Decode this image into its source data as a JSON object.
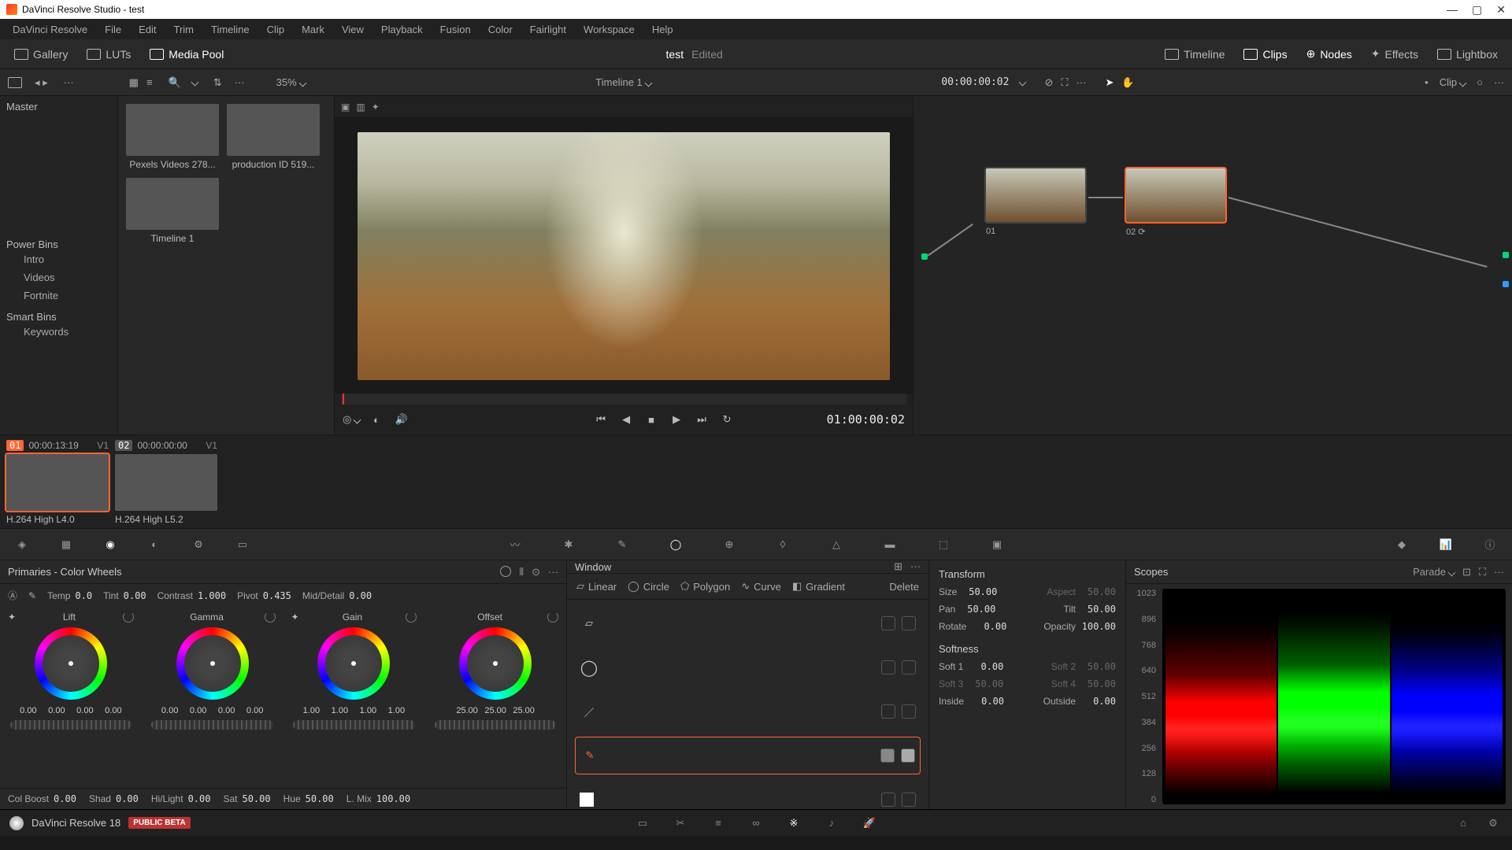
{
  "titlebar": {
    "text": "DaVinci Resolve Studio - test"
  },
  "menu": [
    "DaVinci Resolve",
    "File",
    "Edit",
    "Trim",
    "Timeline",
    "Clip",
    "Mark",
    "View",
    "Playback",
    "Fusion",
    "Color",
    "Fairlight",
    "Workspace",
    "Help"
  ],
  "toptool": {
    "gallery": "Gallery",
    "luts": "LUTs",
    "mediapool": "Media Pool",
    "project_title": "test",
    "project_state": "Edited",
    "timeline": "Timeline",
    "clips": "Clips",
    "nodes": "Nodes",
    "effects": "Effects",
    "lightbox": "Lightbox"
  },
  "subtool": {
    "zoom": "35%",
    "timeline_name": "Timeline 1",
    "timecode": "00:00:00:02",
    "clip_label": "Clip"
  },
  "leftpane": {
    "master": "Master",
    "powerbins_title": "Power Bins",
    "powerbins": [
      "Intro",
      "Videos",
      "Fortnite"
    ],
    "smartbins_title": "Smart Bins",
    "smartbins": [
      "Keywords"
    ]
  },
  "media": {
    "items": [
      {
        "name": "Pexels Videos 278..."
      },
      {
        "name": "production ID 519..."
      },
      {
        "name": "Timeline 1"
      }
    ]
  },
  "viewer": {
    "timecode": "01:00:00:02"
  },
  "nodes": [
    {
      "id": "01",
      "label": "01"
    },
    {
      "id": "02",
      "label": "02  ⟳"
    }
  ],
  "clips": [
    {
      "idx": "01",
      "tc": "00:00:13:19",
      "track": "V1",
      "codec": "H.264 High L4.0"
    },
    {
      "idx": "02",
      "tc": "00:00:00:00",
      "track": "V1",
      "codec": "H.264 High L5.2"
    }
  ],
  "primaries": {
    "title": "Primaries - Color Wheels",
    "params": {
      "temp_l": "Temp",
      "temp": "0.0",
      "tint_l": "Tint",
      "tint": "0.00",
      "contrast_l": "Contrast",
      "contrast": "1.000",
      "pivot_l": "Pivot",
      "pivot": "0.435",
      "mid_l": "Mid/Detail",
      "mid": "0.00"
    },
    "wheels": {
      "lift": {
        "label": "Lift",
        "vals": [
          "0.00",
          "0.00",
          "0.00",
          "0.00"
        ]
      },
      "gamma": {
        "label": "Gamma",
        "vals": [
          "0.00",
          "0.00",
          "0.00",
          "0.00"
        ]
      },
      "gain": {
        "label": "Gain",
        "vals": [
          "1.00",
          "1.00",
          "1.00",
          "1.00"
        ]
      },
      "offset": {
        "label": "Offset",
        "vals": [
          "25.00",
          "25.00",
          "25.00"
        ]
      }
    },
    "bottom": {
      "colboost_l": "Col Boost",
      "colboost": "0.00",
      "shad_l": "Shad",
      "shad": "0.00",
      "hilight_l": "Hi/Light",
      "hilight": "0.00",
      "sat_l": "Sat",
      "sat": "50.00",
      "hue_l": "Hue",
      "hue": "50.00",
      "lmix_l": "L. Mix",
      "lmix": "100.00"
    }
  },
  "window_panel": {
    "title": "Window",
    "tools": {
      "linear": "Linear",
      "circle": "Circle",
      "polygon": "Polygon",
      "curve": "Curve",
      "gradient": "Gradient",
      "delete": "Delete"
    }
  },
  "transform": {
    "title": "Transform",
    "size_l": "Size",
    "size": "50.00",
    "aspect_l": "Aspect",
    "aspect": "50.00",
    "pan_l": "Pan",
    "pan": "50.00",
    "tilt_l": "Tilt",
    "tilt": "50.00",
    "rotate_l": "Rotate",
    "rotate": "0.00",
    "opacity_l": "Opacity",
    "opacity": "100.00",
    "softness_title": "Softness",
    "soft1_l": "Soft 1",
    "soft1": "0.00",
    "soft2_l": "Soft 2",
    "soft2": "50.00",
    "soft3_l": "Soft 3",
    "soft3": "50.00",
    "soft4_l": "Soft 4",
    "soft4": "50.00",
    "inside_l": "Inside",
    "inside": "0.00",
    "outside_l": "Outside",
    "outside": "0.00"
  },
  "scopes": {
    "title": "Scopes",
    "mode": "Parade",
    "ticks": [
      "1023",
      "896",
      "768",
      "640",
      "512",
      "384",
      "256",
      "128",
      "0"
    ]
  },
  "footer": {
    "app": "DaVinci Resolve 18",
    "badge": "PUBLIC BETA"
  }
}
